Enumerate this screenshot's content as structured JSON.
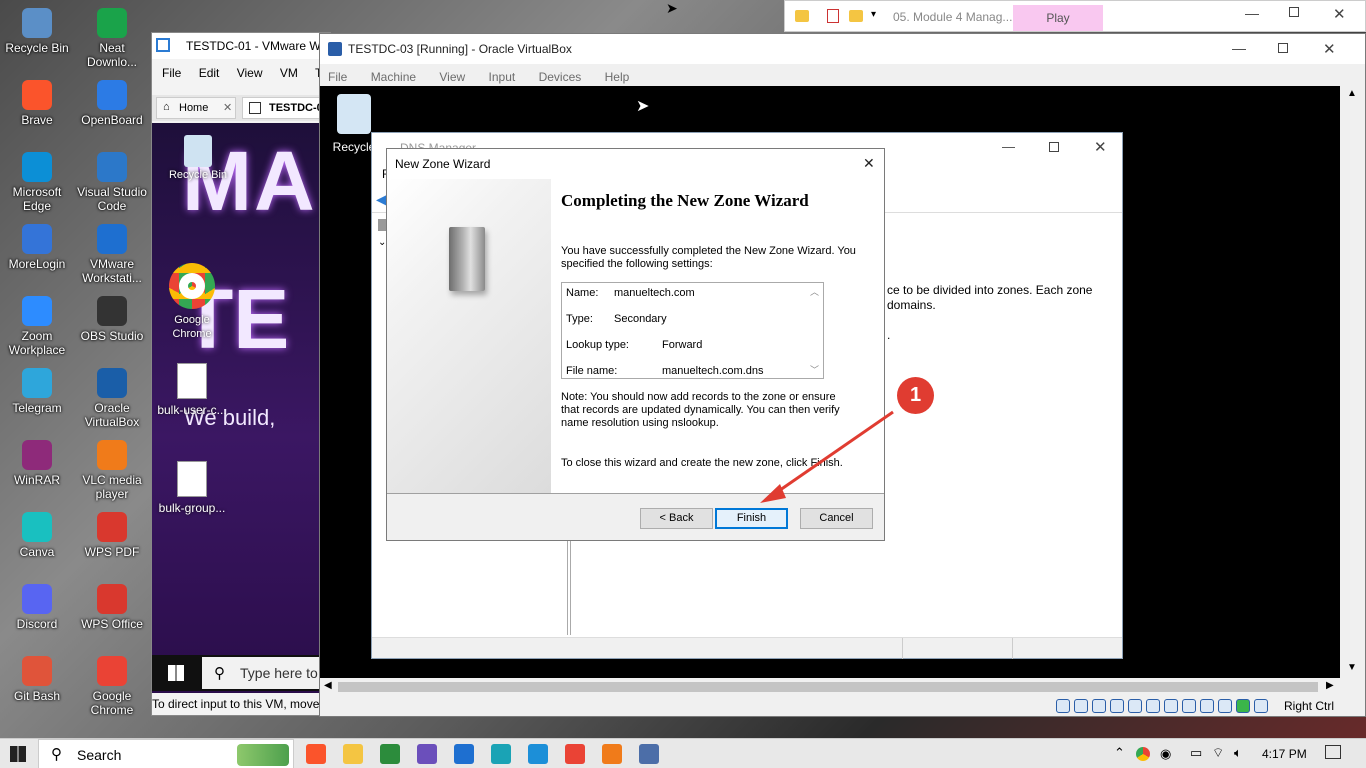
{
  "desktop_icons_left": [
    "Recycle Bin",
    "Brave",
    "Microsoft Edge",
    "MoreLogin",
    "Zoom Workplace",
    "Telegram",
    "WinRAR",
    "Canva",
    "Discord",
    "Git Bash"
  ],
  "desktop_icons_right": [
    "Neat Downlo...",
    "OpenBoard",
    "Visual Studio Code",
    "VMware Workstati...",
    "OBS Studio",
    "Oracle VirtualBox",
    "VLC media player",
    "WPS PDF",
    "WPS Office",
    "Google Chrome"
  ],
  "explorer_tab": {
    "title": "05. Module 4 Manag...",
    "play_label": "Play"
  },
  "vmware": {
    "title": "TESTDC-01 - VMware Wo",
    "menu": [
      "File",
      "Edit",
      "View",
      "VM",
      "Ta"
    ],
    "tabs": {
      "home": "Home",
      "active": "TESTDC-0"
    },
    "guest_icons": [
      "Recycle Bin",
      "Google Chrome",
      "bulk-user-c...",
      "bulk-group..."
    ],
    "banner_text": "We build,",
    "search_placeholder": "Type here to",
    "status": "To direct input to this VM, move"
  },
  "vbox": {
    "title": "TESTDC-03 [Running] - Oracle VirtualBox",
    "menu": [
      "File",
      "Machine",
      "View",
      "Input",
      "Devices",
      "Help"
    ],
    "guest_recycle": "Recycle",
    "right_ctrl": "Right Ctrl"
  },
  "dns": {
    "title": "DNS Manager",
    "menu_first": "F",
    "desc_line1": "ce to be divided into zones. Each zone",
    "desc_line2": "domains.",
    "desc_line3": "."
  },
  "wizard": {
    "title": "New Zone Wizard",
    "heading": "Completing the New Zone Wizard",
    "intro": "You have successfully completed the New Zone Wizard. You specified the following settings:",
    "settings": [
      {
        "label": "Name:",
        "value": "manueltech.com"
      },
      {
        "label": "Type:",
        "value": "Secondary"
      },
      {
        "label": "Lookup type:",
        "value": "Forward"
      },
      {
        "label": "File name:",
        "value": "manueltech.com.dns"
      }
    ],
    "note": "Note: You should now add records to the zone or ensure that records are updated dynamically. You can then verify name resolution using nslookup.",
    "close_text": "To close this wizard and create the new zone, click Finish.",
    "back_label": "< Back",
    "finish_label": "Finish",
    "cancel_label": "Cancel"
  },
  "annotation": {
    "number": "1",
    "color": "#e03c31"
  },
  "taskbar": {
    "search_label": "Search",
    "time": "4:17 PM"
  }
}
